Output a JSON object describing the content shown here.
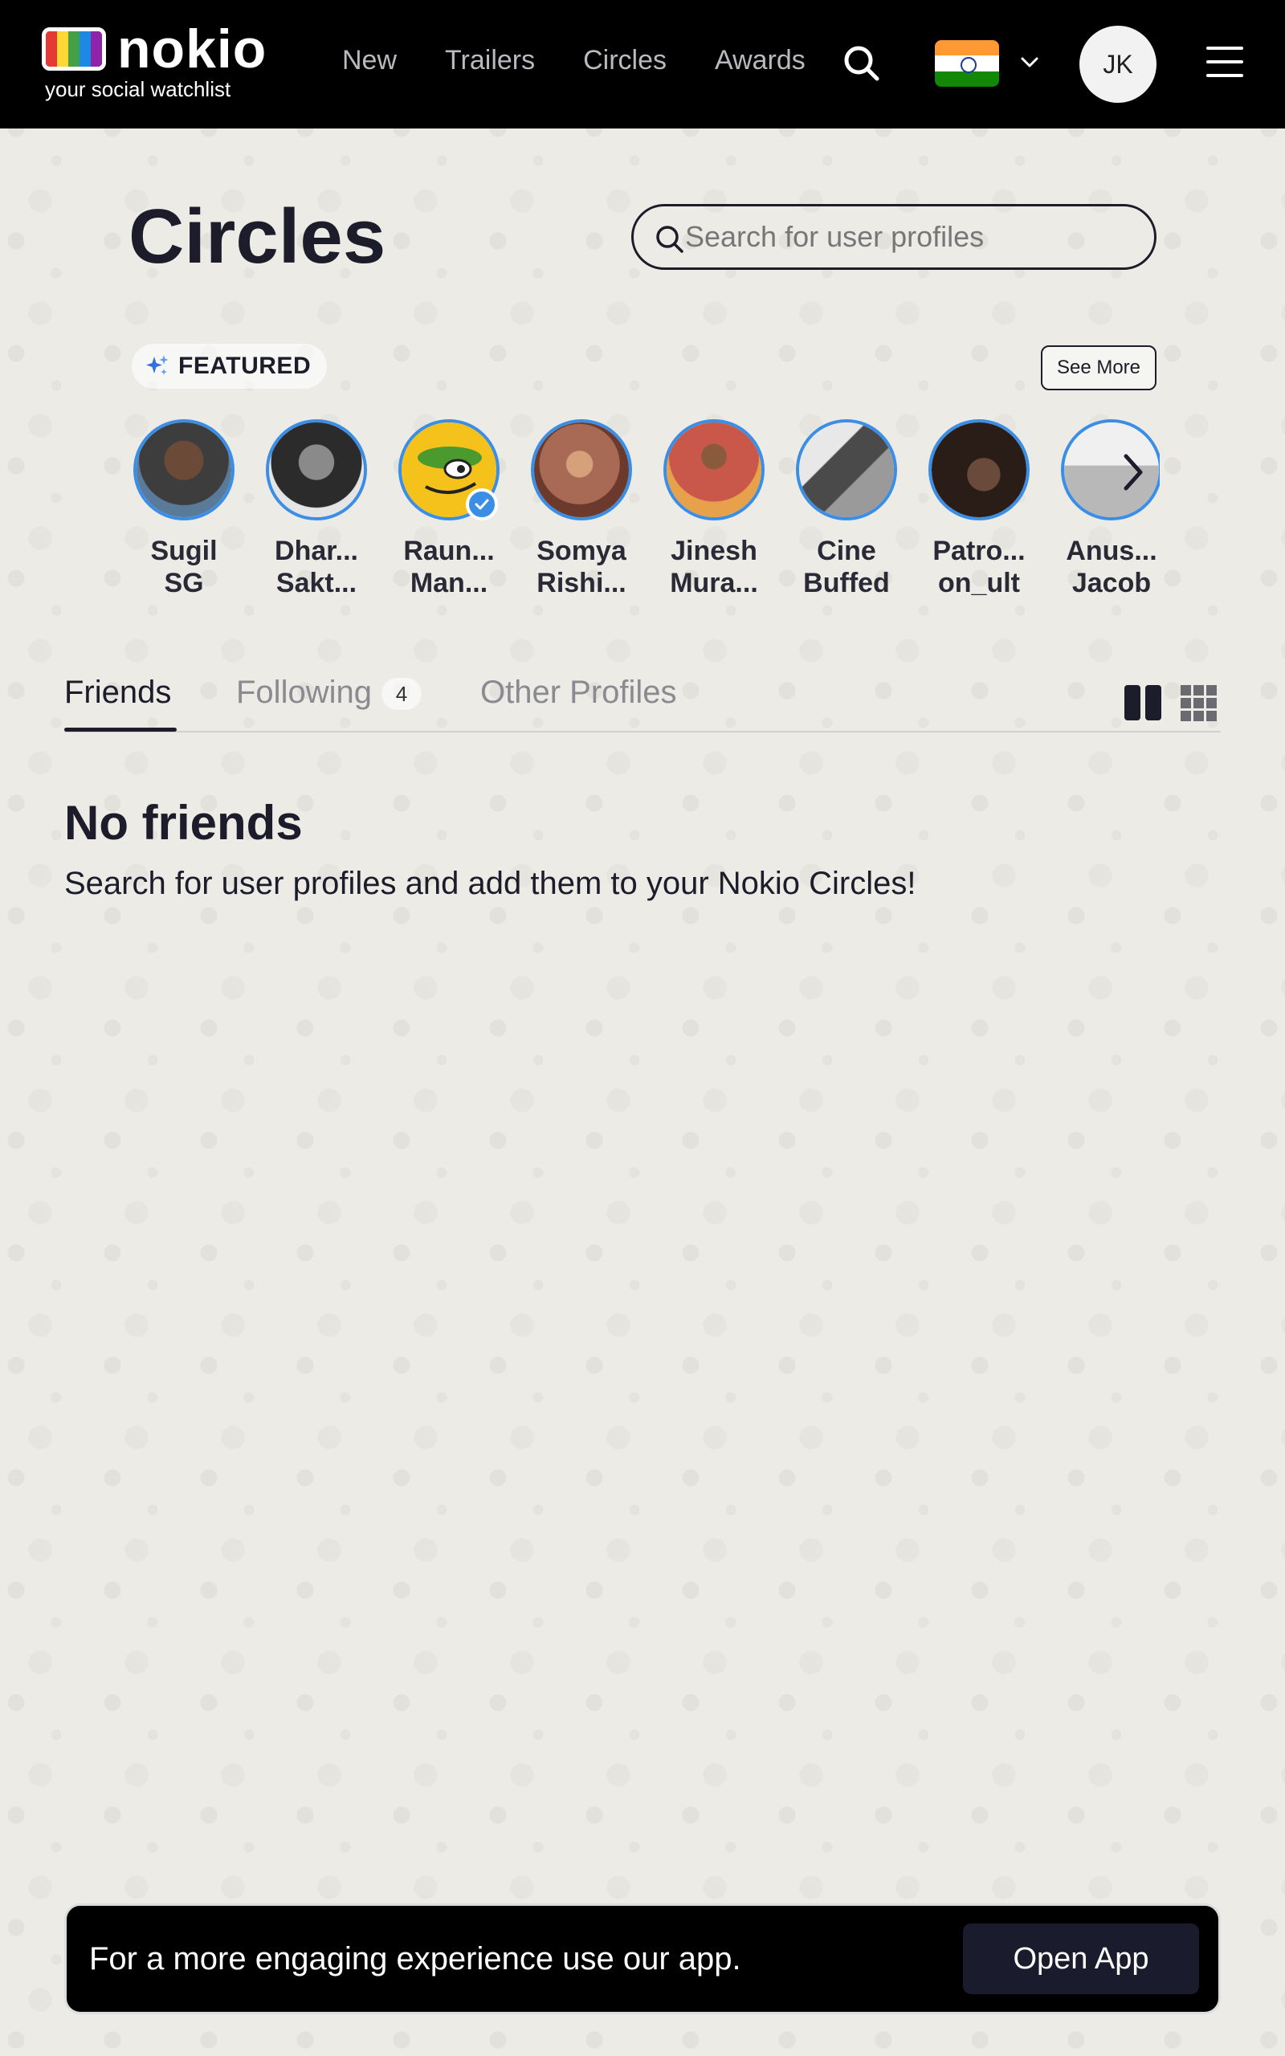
{
  "brand": {
    "name": "nokio",
    "tagline": "your social watchlist",
    "tv_colors": [
      "#e53935",
      "#fdd835",
      "#43a047",
      "#1e88e5",
      "#8e24aa"
    ]
  },
  "nav": {
    "items": [
      "New",
      "Trailers",
      "Circles",
      "Awards"
    ],
    "user_initials": "JK",
    "country_flag": "india-flag-icon"
  },
  "page": {
    "title": "Circles",
    "search_placeholder": "Search for user profiles"
  },
  "featured": {
    "label": "FEATURED",
    "see_more": "See More",
    "profiles": [
      {
        "line1": "Sugil",
        "line2": "SG",
        "verified": false,
        "color": "#3d3d3d"
      },
      {
        "line1": "Dhar...",
        "line2": "Sakt...",
        "verified": false,
        "color": "#2b2b2b"
      },
      {
        "line1": "Raun...",
        "line2": "Man...",
        "verified": true,
        "color": "#f4c21b"
      },
      {
        "line1": "Somya",
        "line2": "Rishi...",
        "verified": false,
        "color": "#a86a54"
      },
      {
        "line1": "Jinesh",
        "line2": "Mura...",
        "verified": false,
        "color": "#c9574a"
      },
      {
        "line1": "Cine",
        "line2": "Buffed",
        "verified": false,
        "color": "#8a8a8a"
      },
      {
        "line1": "Patro...",
        "line2": "on_ult",
        "verified": false,
        "color": "#2a1d18"
      },
      {
        "line1": "Anus...",
        "line2": "Jacob",
        "verified": false,
        "color": "#d8d8d8"
      }
    ]
  },
  "tabs": {
    "friends": "Friends",
    "following": "Following",
    "following_count": "4",
    "other_profiles": "Other Profiles"
  },
  "empty_state": {
    "title": "No friends",
    "message": "Search for user profiles and add them to your Nokio Circles!"
  },
  "app_banner": {
    "message": "For a more engaging experience use our app.",
    "button": "Open App"
  }
}
